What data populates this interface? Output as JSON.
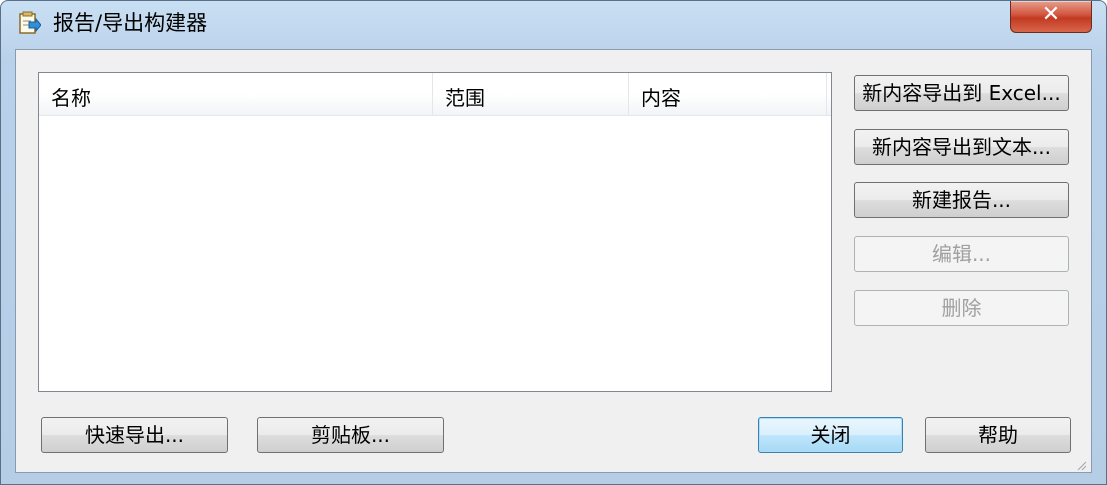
{
  "window": {
    "title": "报告/导出构建器",
    "close_glyph": "✕"
  },
  "list": {
    "columns": [
      "名称",
      "范围",
      "内容"
    ],
    "rows": []
  },
  "side_buttons": {
    "export_excel": "新内容导出到 Excel...",
    "export_text": "新内容导出到文本...",
    "new_report": "新建报告...",
    "edit": "编辑...",
    "delete": "删除"
  },
  "bottom_buttons": {
    "quick_export": "快速导出...",
    "clipboard": "剪贴板...",
    "close": "关闭",
    "help": "帮助"
  },
  "colors": {
    "accent_close": "#c23a22",
    "disabled_text": "#a0a0a0"
  }
}
